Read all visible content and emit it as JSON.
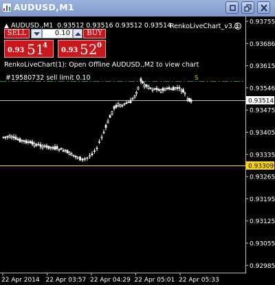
{
  "window": {
    "title": "AUDUSD,M1",
    "buttons": [
      "restore-down",
      "restore",
      "close"
    ]
  },
  "header": {
    "symbol_line": "AUDUSD.,M1",
    "ohlc": "0.93512 0.93516 0.93512 0.93514",
    "indicator": "RenkoLiveChart_v3.3"
  },
  "trade_panel": {
    "sell_label": "SELL",
    "buy_label": "BUY",
    "lot_size": "0.10",
    "sell_price": {
      "prefix": "0.93",
      "big": "51",
      "sup": "4"
    },
    "buy_price": {
      "prefix": "0.93",
      "big": "52",
      "sup": "0"
    }
  },
  "notice": "RenkoLiveChart(1): Open Offline AUDUSD.,M2 to view chart",
  "order": {
    "label": "#19580732 sell limit 0.10",
    "marker": "S"
  },
  "price_axis": {
    "ticks": [
      "0.93755",
      "0.93686",
      "0.93615",
      "0.93546",
      "0.93475",
      "0.93405",
      "0.93335",
      "0.93265",
      "0.93195",
      "0.93125",
      "0.93055",
      "0.92985"
    ],
    "current_price": "0.93514",
    "marked_price": "0.93309"
  },
  "time_axis": {
    "ticks": [
      "22 Apr 2014",
      "22 Apr 03:57",
      "22 Apr 04:29",
      "22 Apr 05:01",
      "22 Apr 05:33"
    ]
  },
  "colors": {
    "background": "#000000",
    "candle_up": "#ffffff",
    "candle_down": "#ffffff",
    "bid_line": "#c0c0c0",
    "marked_line": "#ffd700",
    "order_line": "#2e8b2e",
    "sell_button": "#c8181c"
  }
}
